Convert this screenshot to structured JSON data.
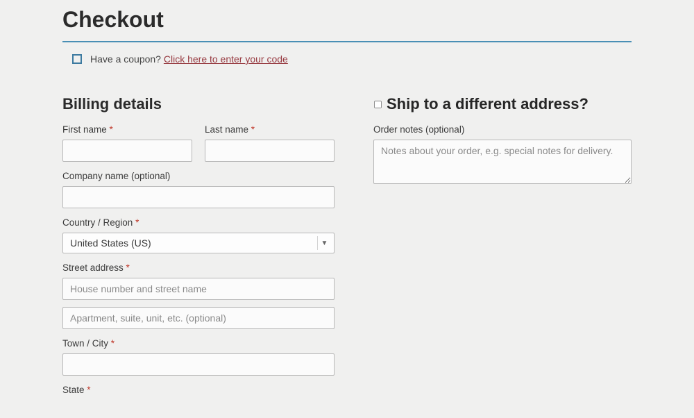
{
  "page": {
    "title": "Checkout"
  },
  "coupon": {
    "prompt": "Have a coupon? ",
    "link_text": "Click here to enter your code"
  },
  "billing": {
    "heading": "Billing details",
    "first_name": {
      "label": "First name ",
      "required": "*"
    },
    "last_name": {
      "label": "Last name ",
      "required": "*"
    },
    "company": {
      "label": "Company name (optional)"
    },
    "country": {
      "label": "Country / Region ",
      "required": "*",
      "selected": "United States (US)"
    },
    "street": {
      "label": "Street address ",
      "required": "*",
      "placeholder1": "House number and street name",
      "placeholder2": "Apartment, suite, unit, etc. (optional)"
    },
    "city": {
      "label": "Town / City ",
      "required": "*"
    },
    "state": {
      "label": "State ",
      "required": "*"
    }
  },
  "shipping": {
    "heading": "Ship to a different address?",
    "order_notes": {
      "label": "Order notes (optional)",
      "placeholder": "Notes about your order, e.g. special notes for delivery."
    }
  }
}
